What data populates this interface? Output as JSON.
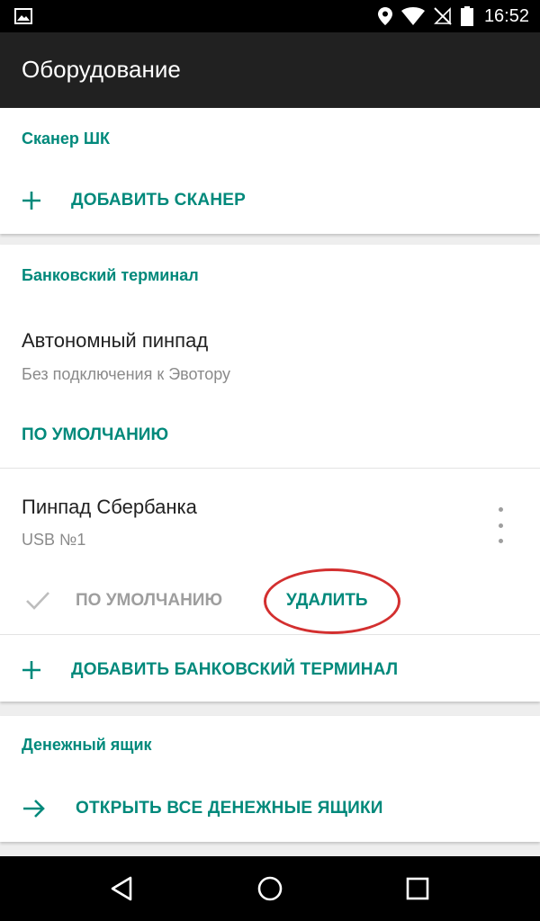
{
  "status_bar": {
    "time": "16:52",
    "icons": [
      "gallery-icon",
      "location-icon",
      "wifi-icon",
      "no-sim-icon",
      "battery-icon"
    ]
  },
  "app_bar": {
    "title": "Оборудование"
  },
  "scanner_section": {
    "header": "Сканер ШК",
    "add_label": "ДОБАВИТЬ СКАНЕР"
  },
  "bank_section": {
    "header": "Банковский терминал",
    "devices": [
      {
        "name": "Автономный пинпад",
        "subtitle": "Без подключения к Эвотору",
        "default_label": "ПО УМОЛЧАНИЮ"
      },
      {
        "name": "Пинпад Сбербанка",
        "subtitle": "USB №1",
        "default_label": "ПО УМОЛЧАНИЮ",
        "delete_label": "УДАЛИТЬ"
      }
    ],
    "add_label": "ДОБАВИТЬ БАНКОВСКИЙ ТЕРМИНАЛ"
  },
  "cash_section": {
    "header": "Денежный ящик",
    "open_all_label": "ОТКРЫТЬ ВСЕ ДЕНЕЖНЫЕ ЯЩИКИ"
  },
  "colors": {
    "accent": "#00897b",
    "app_bar": "#212121",
    "highlight": "#d32f2f",
    "secondary_text": "#8a8a8a"
  }
}
